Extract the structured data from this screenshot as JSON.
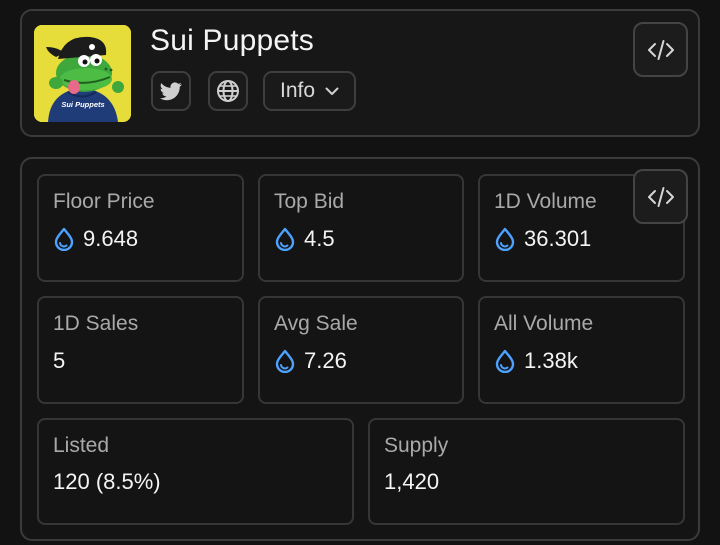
{
  "collection": {
    "name": "Sui Puppets",
    "avatar_text": "Sui Puppets"
  },
  "header": {
    "info_label": "Info"
  },
  "stats": [
    {
      "label": "Floor Price",
      "value": "9.648",
      "currency_icon": "sui-drop-icon"
    },
    {
      "label": "Top Bid",
      "value": "4.5",
      "currency_icon": "sui-drop-icon"
    },
    {
      "label": "1D Volume",
      "value": "36.301",
      "currency_icon": "sui-drop-icon"
    },
    {
      "label": "1D Sales",
      "value": "5",
      "currency_icon": ""
    },
    {
      "label": "Avg Sale",
      "value": "7.26",
      "currency_icon": "sui-drop-icon"
    },
    {
      "label": "All Volume",
      "value": "1.38k",
      "currency_icon": "sui-drop-icon"
    },
    {
      "label": "Listed",
      "value": "120 (8.5%)",
      "currency_icon": ""
    },
    {
      "label": "Supply",
      "value": "1,420",
      "currency_icon": ""
    }
  ],
  "colors": {
    "background": "#121212",
    "card": "#171717",
    "border": "#3b3b3b",
    "label": "#a9a9a9",
    "value": "#f4f4f4",
    "sui_blue": "#4da2ff",
    "avatar_bg": "#e6dc3a"
  }
}
